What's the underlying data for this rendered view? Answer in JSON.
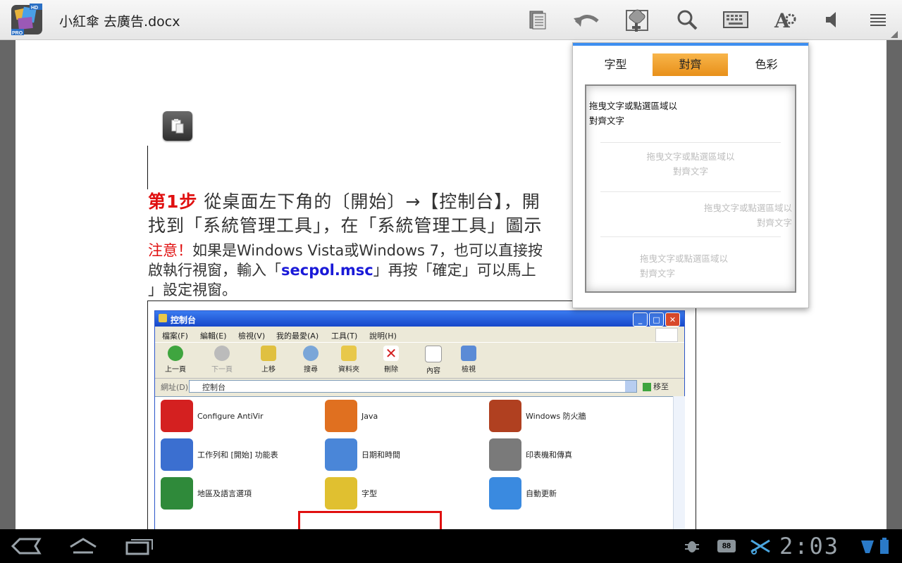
{
  "app": {
    "icon_name": "quickoffice-pro-hd-icon",
    "icon_badges": [
      "HD",
      "PRO"
    ],
    "document_title": "小紅傘 去廣告.docx"
  },
  "toolbar": {
    "buttons": [
      {
        "name": "document-view-icon"
      },
      {
        "name": "undo-icon"
      },
      {
        "name": "insert-image-icon"
      },
      {
        "name": "search-icon"
      },
      {
        "name": "keyboard-icon"
      },
      {
        "name": "text-format-icon"
      },
      {
        "name": "speaker-icon"
      },
      {
        "name": "menu-icon"
      }
    ]
  },
  "document": {
    "step_label": "第1步",
    "line1_text": " 從桌面左下角的〔開始〕→【控制台】，開",
    "line2_text": "找到「系統管理工具」，在「系統管理工具」圖示",
    "note_label": "注意！",
    "line3_text": "如果是Windows Vista或Windows 7，也可以直接按",
    "line4_pre": "啟執行視窗，輸入「",
    "line4_cmd": "secpol.msc",
    "line4_post": "」再按「確定」可以馬上",
    "line5_text": "」設定視窗。"
  },
  "embedded_screenshot": {
    "window_title": "控制台",
    "menu": [
      "檔案(F)",
      "編輯(E)",
      "檢視(V)",
      "我的最愛(A)",
      "工具(T)",
      "說明(H)"
    ],
    "toolbar": [
      "上一頁",
      "下一頁",
      "上移",
      "搜尋",
      "資料夾",
      "刪除",
      "內容",
      "檢視"
    ],
    "address_label": "網址(D)",
    "address_value": "控制台",
    "go_label": "移至",
    "items": [
      {
        "label": "Configure AntiVir",
        "color": "#d42020"
      },
      {
        "label": "Java",
        "color": "#e07020"
      },
      {
        "label": "Windows 防火牆",
        "color": "#b04020"
      },
      {
        "label": "工作列和 [開始] 功能表",
        "color": "#3b6fd0"
      },
      {
        "label": "日期和時間",
        "color": "#4a86d8"
      },
      {
        "label": "印表機和傳真",
        "color": "#7a7a7a"
      },
      {
        "label": "地區及語言選項",
        "color": "#2f8a3a"
      },
      {
        "label": "字型",
        "color": "#e0c030"
      },
      {
        "label": "自動更新",
        "color": "#3a8ae0"
      }
    ]
  },
  "popup": {
    "tabs": [
      "字型",
      "對齊",
      "色彩"
    ],
    "active_tab": 1,
    "preview_text": "拖曳文字或點選區域以\n對齊文字",
    "accent_color": "#f0a030"
  },
  "system_bar": {
    "clock": "2:03",
    "notification_badge": "88"
  }
}
